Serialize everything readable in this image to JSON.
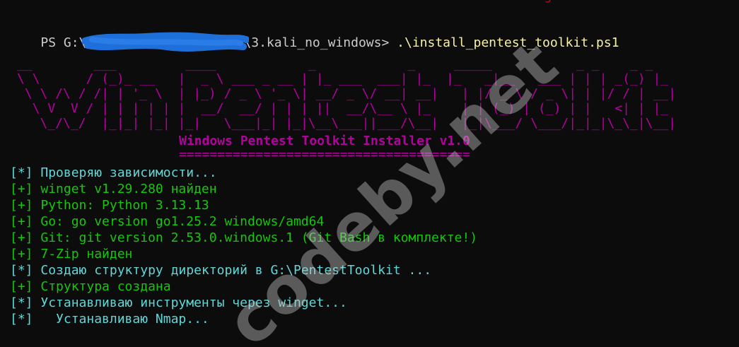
{
  "terminal": {
    "top_partial": "                                                                       g               r",
    "prompt": {
      "prefix": "PS G:\\",
      "path_suffix": "\\3.kali_no_windows> ",
      "command": ".\\install_pentest_toolkit.ps1"
    },
    "banner_lines": [
      "__        ___         ____            _            _     _____           _ _    _ _   ",
      "\\ \\      / (_)_ __   |  _ \\ ___ _ __ | |_ ___  ___| |_  |_   _|__   ___ | | | _(_) |_ ",
      " \\ \\ /\\ / /| | '_ \\  | |_) / _ \\ '_ \\| __/ _ \\/ __| __|   | |/ _ \\ / _ \\| | |/ / | __|",
      "  \\ V  V / | | | | | |  __/  __/ | | | ||  __/\\__ \\ |_    | | (_) | (_) | |   <| | |_ ",
      "   \\_/\\_/  |_|_| |_| |_|   \\___|_| |_|\\__\\___||___/\\__|   |_|\\___/ \\___/|_|_|\\_\\_|\\__|"
    ],
    "installer_title": "Windows Pentest Toolkit Installer v1.0",
    "installer_rule": "======================================",
    "log": [
      {
        "tag": "[*]",
        "text": " Проверяю зависимости...",
        "color": "#61d6d6"
      },
      {
        "tag": "[+]",
        "text": " winget v1.29.280 найден",
        "color": "#16c60c"
      },
      {
        "tag": "[+]",
        "text": " Python: Python 3.13.13",
        "color": "#16c60c"
      },
      {
        "tag": "[+]",
        "text": " Go: go version go1.25.2 windows/amd64",
        "color": "#16c60c"
      },
      {
        "tag": "[+]",
        "text": " Git: git version 2.53.0.windows.1 (Git Bash в комплекте!)",
        "color": "#16c60c"
      },
      {
        "tag": "[+]",
        "text": " 7-Zip найден",
        "color": "#16c60c"
      },
      {
        "tag": "[*]",
        "text": " Создаю структуру директорий в G:\\PentestToolkit ...",
        "color": "#61d6d6"
      },
      {
        "tag": "[+]",
        "text": " Структура создана",
        "color": "#16c60c"
      },
      {
        "tag": "[*]",
        "text": " Устанавливаю инструменты через winget...",
        "color": "#61d6d6"
      },
      {
        "tag": "[*]",
        "text": "   Устанавливаю Nmap...",
        "color": "#61d6d6"
      }
    ]
  },
  "watermark": "codeby.net",
  "colors": {
    "background": "#0c0c0c",
    "banner": "#b4009e",
    "cyan": "#61d6d6",
    "green": "#16c60c",
    "command": "#f9f1a5",
    "redaction": "#1e6fd9"
  }
}
